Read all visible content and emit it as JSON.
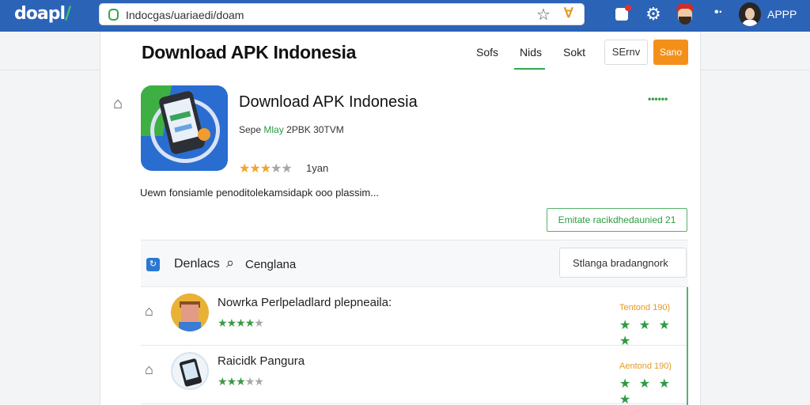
{
  "browser": {
    "logo_text": "doapl",
    "logo_slash": "/",
    "url": "Indocgas/uariaedi/doam",
    "app_label": "APPP"
  },
  "header": {
    "title": "Download APK Indonesia",
    "nav": [
      "Sofs",
      "Nids",
      "Sokt"
    ],
    "signin_label": "SErnv",
    "cta_label": "Sano"
  },
  "app": {
    "name": "Download APK Indonesia",
    "meta_prefix": "Sepe",
    "meta_green": "Mlay",
    "meta_suffix": "2PBK 30TVM",
    "rating": 3,
    "rating_max": 5,
    "age": "1yan",
    "dots": "••••••",
    "description": "Uewn fonsiamle penoditolekamsidapk ooo plassim...",
    "action_label": "Emitate racikdhedaunied 21"
  },
  "toolbar": {
    "label": "Denlacs",
    "search_text": "Cenglana",
    "input_value": "Stlanga bradangnork"
  },
  "list": [
    {
      "title": "Nowrka Perlpeladlard plepneaila:",
      "stars": 4,
      "price": "Tentond 190)",
      "rating": "★ ★ ★ ★"
    },
    {
      "title": "Raicidk Pangura",
      "stars": 3,
      "price": "Aentond 190)",
      "rating": "★ ★ ★ ★"
    }
  ],
  "colors": {
    "topbar": "#2b63b7",
    "accent_green": "#2f9a43",
    "accent_orange": "#f4901a"
  }
}
